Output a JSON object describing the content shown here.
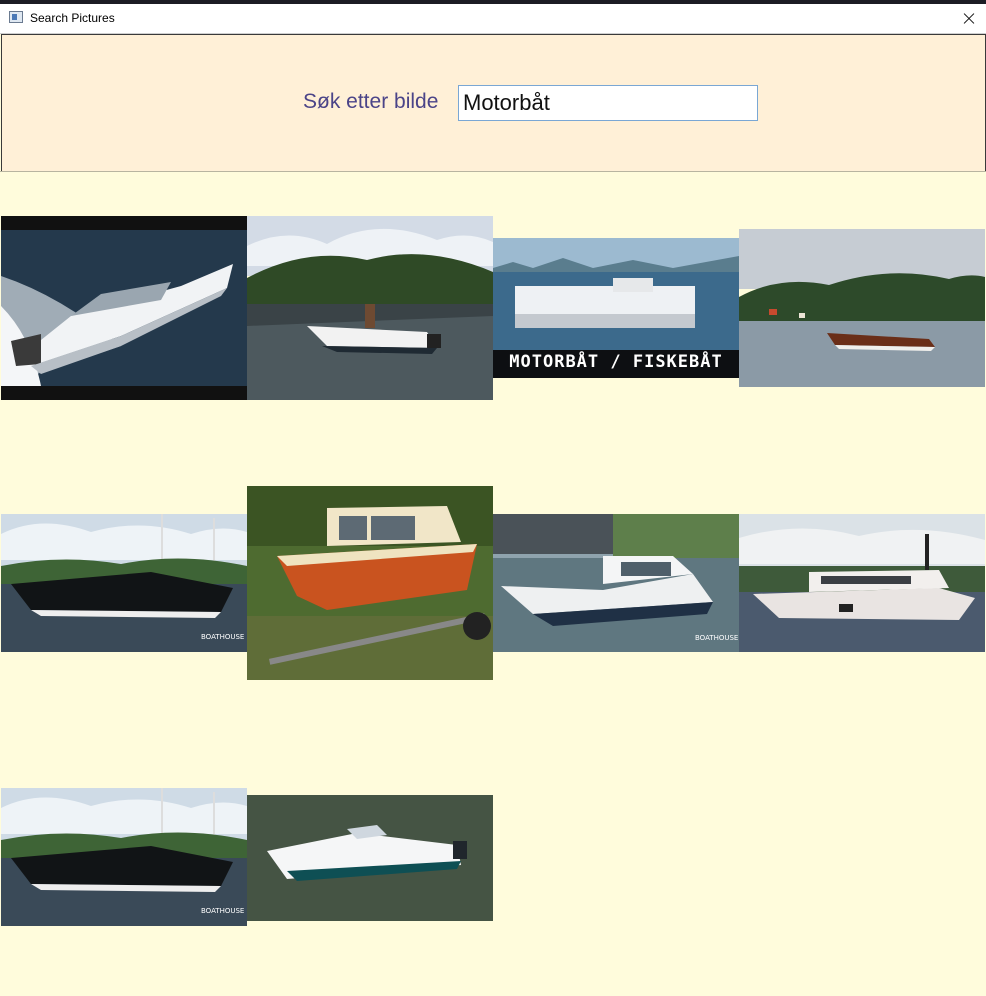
{
  "window": {
    "title": "Search Pictures"
  },
  "search": {
    "label": "Søk etter bilde",
    "value": "Motorbåt"
  },
  "results": [
    {
      "alt": "white motor yacht speeding"
    },
    {
      "alt": "small white motorboat near island"
    },
    {
      "alt": "minecraft motorboat",
      "caption": "MOTORBÅT / FISKEBÅT"
    },
    {
      "alt": "wooden runabout boat"
    },
    {
      "alt": "black sport yacht in marina",
      "watermark": "BOATHOUSE"
    },
    {
      "alt": "orange boat on trailer"
    },
    {
      "alt": "white cabin boat in harbor",
      "watermark": "BOATHOUSE"
    },
    {
      "alt": "white motor yacht with flybridge"
    },
    {
      "alt": "black sport yacht in marina",
      "watermark": "BOATHOUSE"
    },
    {
      "alt": "white speedboat on green water"
    }
  ]
}
